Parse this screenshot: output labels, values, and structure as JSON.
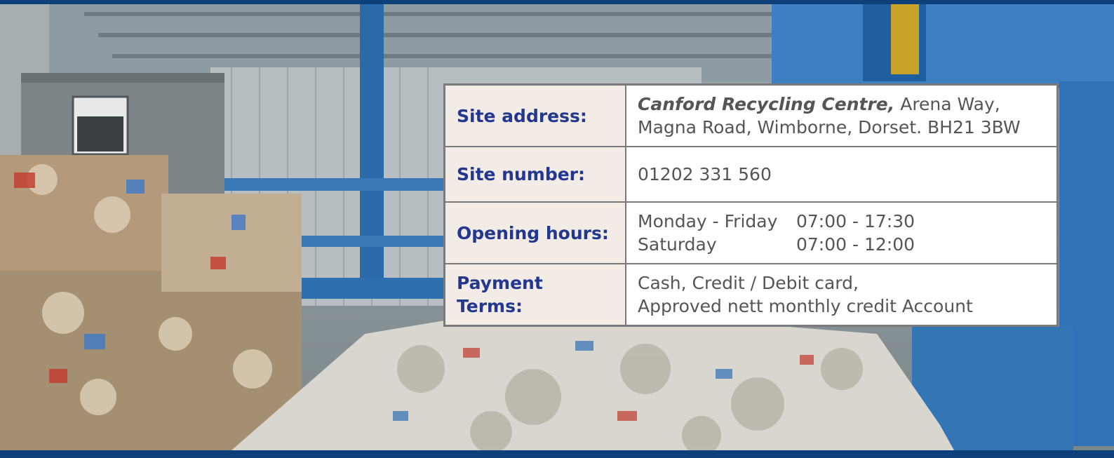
{
  "site": {
    "address_label": "Site address:",
    "address_emphasis": "Canford Recycling Centre,",
    "address_line1_rest": " Arena Way,",
    "address_line2": "Magna Road, Wimborne, Dorset. BH21 3BW",
    "number_label": "Site number:",
    "number_value": "01202 331 560",
    "hours_label": "Opening hours:",
    "hours": [
      {
        "day": "Monday - Friday",
        "time": "07:00 - 17:30"
      },
      {
        "day": "Saturday",
        "time": "07:00 - 12:00"
      }
    ],
    "payment_label": "Payment Terms:",
    "payment_line1": "Cash, Credit / Debit card,",
    "payment_line2": "Approved nett monthly credit Account"
  },
  "colors": {
    "frame": "#0d3f7a",
    "label_bg": "#f3ece6",
    "label_text": "#22378f",
    "value_text": "#555555",
    "border": "#7a7a7a"
  }
}
